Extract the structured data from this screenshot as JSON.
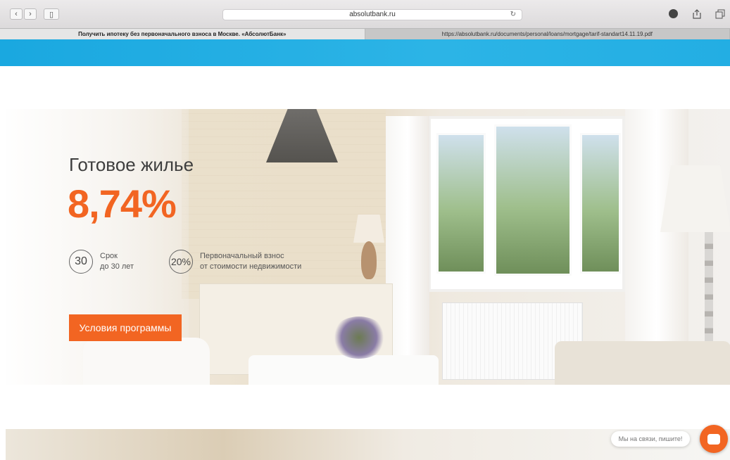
{
  "browser": {
    "url": "absolutbank.ru",
    "reload_glyph": "↻",
    "back_glyph": "‹",
    "forward_glyph": "›",
    "sidebar_glyph": "▯",
    "tabs": [
      {
        "label": "Получить ипотеку без первоначального взноса в Москве. «АбсолютБанк»"
      },
      {
        "label": "https://absolutbank.ru/documents/personal/loans/mortgage/tarif-standart14.11.19.pdf"
      }
    ]
  },
  "hero": {
    "title": "Готовое жилье",
    "rate": "8,74%",
    "stat1": {
      "circle": "30",
      "line1": "Срок",
      "line2": "до 30 лет"
    },
    "stat2": {
      "circle": "20%",
      "line1": "Первоначальный взнос",
      "line2": "от стоимости недвижимости"
    },
    "cta": "Условия программы"
  },
  "chat": {
    "label": "Мы на связи, пишите!"
  },
  "colors": {
    "accent": "#f26522",
    "header": "#1aa8e0"
  }
}
